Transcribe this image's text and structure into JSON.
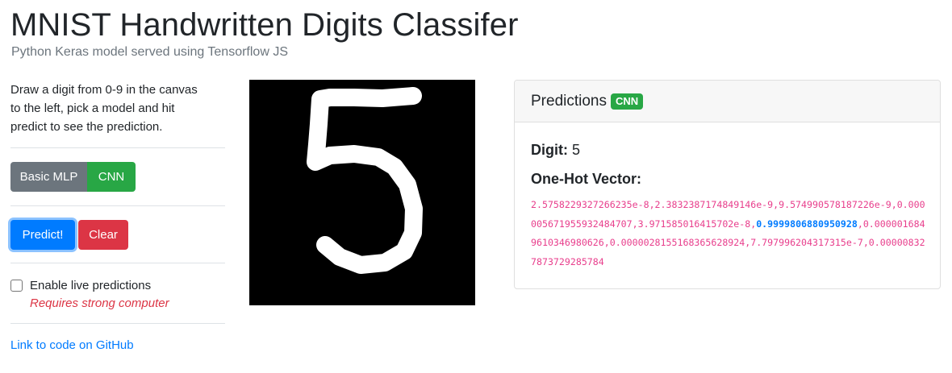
{
  "header": {
    "title": "MNIST Handwritten Digits Classifer",
    "subtitle": "Python Keras model served using Tensorflow JS"
  },
  "sidebar": {
    "instructions": "Draw a digit from 0-9 in the canvas to the left, pick a model and hit predict to see the prediction.",
    "model_buttons": [
      "Basic MLP",
      "CNN"
    ],
    "selected_model": "CNN",
    "predict_label": "Predict!",
    "clear_label": "Clear",
    "live_label": "Enable live predictions",
    "live_checked": false,
    "live_note": "Requires strong computer",
    "github_link": "Link to code on GitHub"
  },
  "canvas": {
    "drawn_digit": "5",
    "background": "#000000",
    "stroke": "#ffffff"
  },
  "predictions": {
    "title": "Predictions",
    "badge": "CNN",
    "digit_label": "Digit:",
    "digit_value": "5",
    "vector_title": "One-Hot Vector:",
    "vector_before": "2.5758229327266235e-8,2.3832387174849146e-9,9.574990578187226e-9,0.00000567195593248470​7,3.971585016415702e-8,",
    "vector_highlight": "0.9999806880950928",
    "vector_after": ",0.000001684961034698062​6,0.0000028155168365628924,7.797996204317315e-7,0.000008327873729285784"
  },
  "colors": {
    "primary": "#007bff",
    "success": "#28a745",
    "danger": "#dc3545",
    "secondary": "#6c757d",
    "code": "#e83e8c"
  }
}
